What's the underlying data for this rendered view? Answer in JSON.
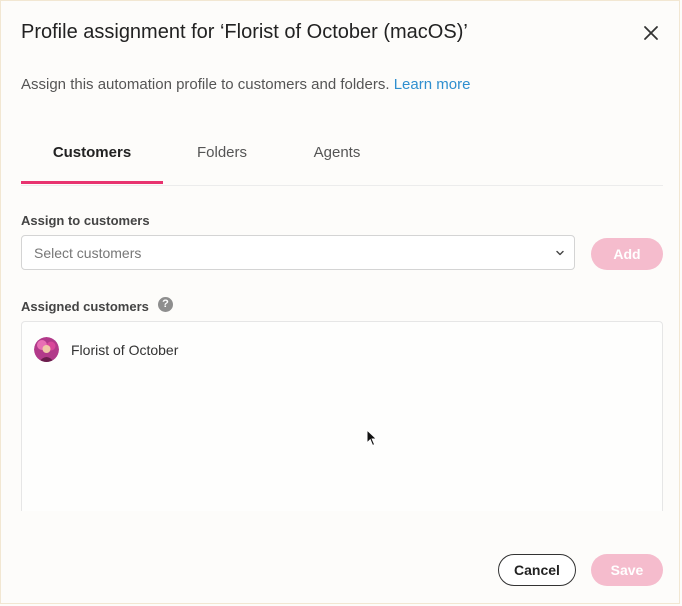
{
  "dialog": {
    "title": "Profile assignment for ‘Florist of October (macOS)’",
    "subtitle": "Assign this automation profile to customers and folders.",
    "learn_more": "Learn more"
  },
  "tabs": [
    {
      "label": "Customers",
      "active": true
    },
    {
      "label": "Folders",
      "active": false
    },
    {
      "label": "Agents",
      "active": false
    }
  ],
  "assign": {
    "label": "Assign to customers",
    "placeholder": "Select customers",
    "add_label": "Add"
  },
  "assigned": {
    "label": "Assigned customers",
    "help": "?",
    "items": [
      {
        "name": "Florist of October"
      }
    ]
  },
  "footer": {
    "cancel_label": "Cancel",
    "save_label": "Save"
  },
  "colors": {
    "accent": "#e8336f",
    "button_disabled": "#f5bccd",
    "link": "#2f8fcf"
  }
}
